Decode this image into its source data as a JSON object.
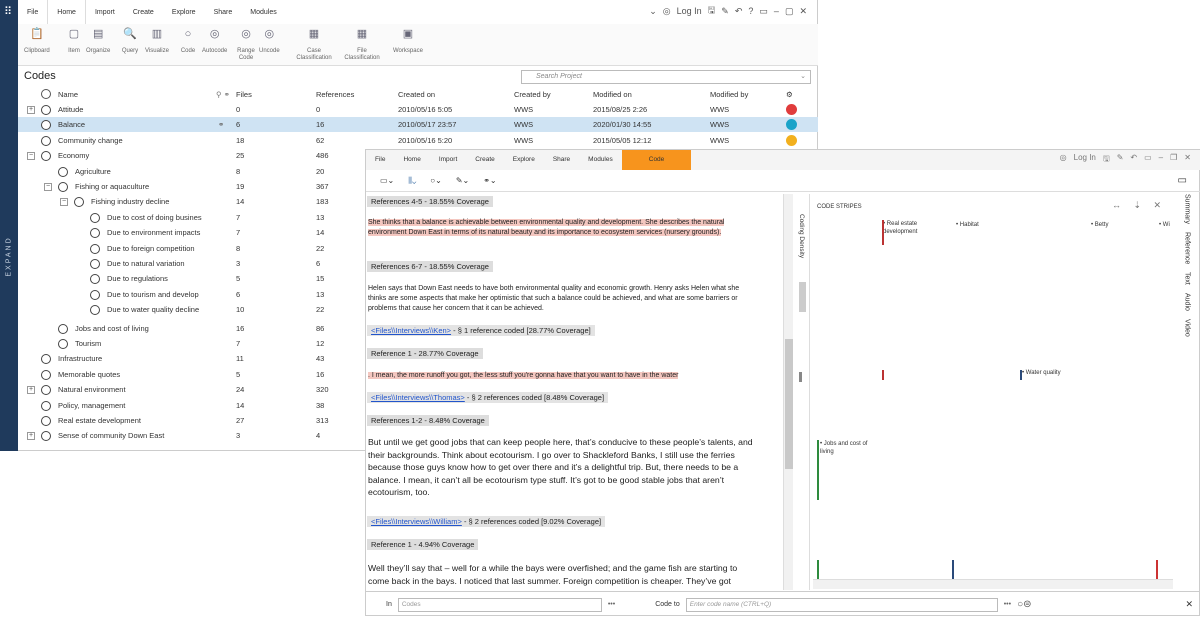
{
  "sidebar": {
    "expand_label": "EXPAND"
  },
  "window1": {
    "menu": [
      "File",
      "Home",
      "Import",
      "Create",
      "Explore",
      "Share",
      "Modules"
    ],
    "login": "Log In",
    "ribbon": [
      {
        "label": "Clipboard",
        "icon": "clipboard-icon"
      },
      {
        "label": "Item",
        "icon": "item-icon"
      },
      {
        "label": "Organize",
        "icon": "organize-icon"
      },
      {
        "label": "Query",
        "icon": "query-icon"
      },
      {
        "label": "Visualize",
        "icon": "visualize-icon"
      },
      {
        "label": "Code",
        "icon": "code-icon"
      },
      {
        "label": "Autocode",
        "icon": "autocode-icon"
      },
      {
        "label": "Range Code",
        "icon": "range-code-icon"
      },
      {
        "label": "Uncode",
        "icon": "uncode-icon"
      },
      {
        "label": "Case Classification",
        "icon": "case-classification-icon"
      },
      {
        "label": "File Classification",
        "icon": "file-classification-icon"
      },
      {
        "label": "Workspace",
        "icon": "workspace-icon"
      }
    ],
    "title": "Codes",
    "search_placeholder": "Search Project",
    "headers": {
      "name": "Name",
      "files": "Files",
      "references": "References",
      "created_on": "Created on",
      "created_by": "Created by",
      "modified_on": "Modified on",
      "modified_by": "Modified by"
    },
    "rows": [
      {
        "name": "Attitude",
        "files": "0",
        "refs": "0",
        "created": "2010/05/16 5:05",
        "cby": "WWS",
        "modified": "2015/08/25 2:26",
        "mby": "WWS",
        "level": 0,
        "expander": "+",
        "color": "#e03c3c",
        "selected": false
      },
      {
        "name": "Balance",
        "files": "6",
        "refs": "16",
        "created": "2010/05/17 23:57",
        "cby": "WWS",
        "modified": "2020/01/30 14:55",
        "mby": "WWS",
        "level": 0,
        "expander": "",
        "color": "#1aa3c8",
        "selected": true
      },
      {
        "name": "Community change",
        "files": "18",
        "refs": "62",
        "created": "2010/05/16 5:20",
        "cby": "WWS",
        "modified": "2015/05/05 12:12",
        "mby": "WWS",
        "level": 0,
        "expander": "",
        "color": "#f2b01e",
        "selected": false
      },
      {
        "name": "Economy",
        "files": "25",
        "refs": "486",
        "level": 0,
        "expander": "−"
      },
      {
        "name": "Agriculture",
        "files": "8",
        "refs": "20",
        "level": 1,
        "expander": ""
      },
      {
        "name": "Fishing or aquaculture",
        "files": "19",
        "refs": "367",
        "level": 1,
        "expander": "−"
      },
      {
        "name": "Fishing industry decline",
        "files": "14",
        "refs": "183",
        "level": 2,
        "expander": "−"
      },
      {
        "name": "Due to cost of doing busines",
        "files": "7",
        "refs": "13",
        "level": 3,
        "expander": ""
      },
      {
        "name": "Due to environment impacts",
        "files": "7",
        "refs": "14",
        "level": 3,
        "expander": ""
      },
      {
        "name": "Due to foreign competition",
        "files": "8",
        "refs": "22",
        "level": 3,
        "expander": ""
      },
      {
        "name": "Due to natural variation",
        "files": "3",
        "refs": "6",
        "level": 3,
        "expander": ""
      },
      {
        "name": "Due to regulations",
        "files": "5",
        "refs": "15",
        "level": 3,
        "expander": ""
      },
      {
        "name": "Due to tourism and develop",
        "files": "6",
        "refs": "13",
        "level": 3,
        "expander": ""
      },
      {
        "name": "Due to water quality decline",
        "files": "10",
        "refs": "22",
        "level": 3,
        "expander": ""
      },
      {
        "name": "Jobs and cost of living",
        "files": "16",
        "refs": "86",
        "level": 1,
        "expander": ""
      },
      {
        "name": "Tourism",
        "files": "7",
        "refs": "12",
        "level": 1,
        "expander": ""
      },
      {
        "name": "Infrastructure",
        "files": "11",
        "refs": "43",
        "level": 0,
        "expander": ""
      },
      {
        "name": "Memorable quotes",
        "files": "5",
        "refs": "16",
        "level": 0,
        "expander": ""
      },
      {
        "name": "Natural environment",
        "files": "24",
        "refs": "320",
        "level": 0,
        "expander": "+"
      },
      {
        "name": "Policy, management",
        "files": "14",
        "refs": "38",
        "level": 0,
        "expander": ""
      },
      {
        "name": "Real estate development",
        "files": "27",
        "refs": "313",
        "level": 0,
        "expander": ""
      },
      {
        "name": "Sense of community Down East",
        "files": "3",
        "refs": "4",
        "level": 0,
        "expander": "+"
      }
    ]
  },
  "window2": {
    "menu": [
      "File",
      "Home",
      "Import",
      "Create",
      "Explore",
      "Share",
      "Modules",
      "Code"
    ],
    "login": "Log In",
    "coding_density": "Coding Density",
    "code_stripes_title": "CODE STRIPES",
    "stripe_labels": [
      "Real estate development",
      "Habitat",
      "Betty",
      "Wi",
      "Water quality",
      "Jobs and cost of living"
    ],
    "right_tabs": [
      "Summary",
      "Reference",
      "Text",
      "Audio",
      "Video"
    ],
    "content": {
      "ref45": "References 4-5 - 18.55% Coverage",
      "p1": "She thinks that a balance is achievable between environmental quality and development. She describes the natural environment Down East in terms of its natural beauty and its importance to ecosystem services (nursery grounds).",
      "ref67": "References 6-7 - 18.55% Coverage",
      "p2": "Helen says that Down East needs to have both environmental quality and economic growth. Henry asks Helen what she thinks are some aspects that make her optimistic that such a balance could be achieved, and what are some barriers or problems that cause her concern that it can be achieved.",
      "ken_link": "<Files\\\\Interviews\\\\Ken>",
      "ken_meta": " - § 1 reference coded  [28.77% Coverage]",
      "ref1a": "Reference 1 - 28.77% Coverage",
      "p3": ". I mean, the more runoff you got, the less stuff you're gonna have that you want to have in the water",
      "thomas_link": "<Files\\\\Interviews\\\\Thomas>",
      "thomas_meta": " - § 2 references coded  [8.48% Coverage]",
      "ref12": "References 1-2 - 8.48% Coverage",
      "p4": " But until we get good jobs that can keep people here, that’s conducive to these people’s talents, and their backgrounds. Think about ecotourism. I go over to Shackleford Banks, I still use the ferries because those guys know how to get over there and it’s a delightful trip. But, there needs to be a balance. I mean, it can’t all be ecotourism type stuff. It’s got to be good stable jobs that aren’t ecotourism, too.",
      "william_link": "<Files\\\\Interviews\\\\William>",
      "william_meta": " - § 2 references coded  [9.02% Coverage]",
      "ref1b": "Reference 1 - 4.94% Coverage",
      "p5": "Well they’ll say that – well for a while the bays were overfished; and the game fish are starting to come back in the bays. I noticed that last summer. Foreign competition is cheaper. They’ve got poaching of tooth over shrimp imported from Asia. A lot of those folks were shrimpers however"
    },
    "bottom": {
      "in_label": "In",
      "in_value": "Codes",
      "code_to_label": "Code to",
      "code_placeholder": "Enter code name (CTRL+Q)"
    }
  }
}
